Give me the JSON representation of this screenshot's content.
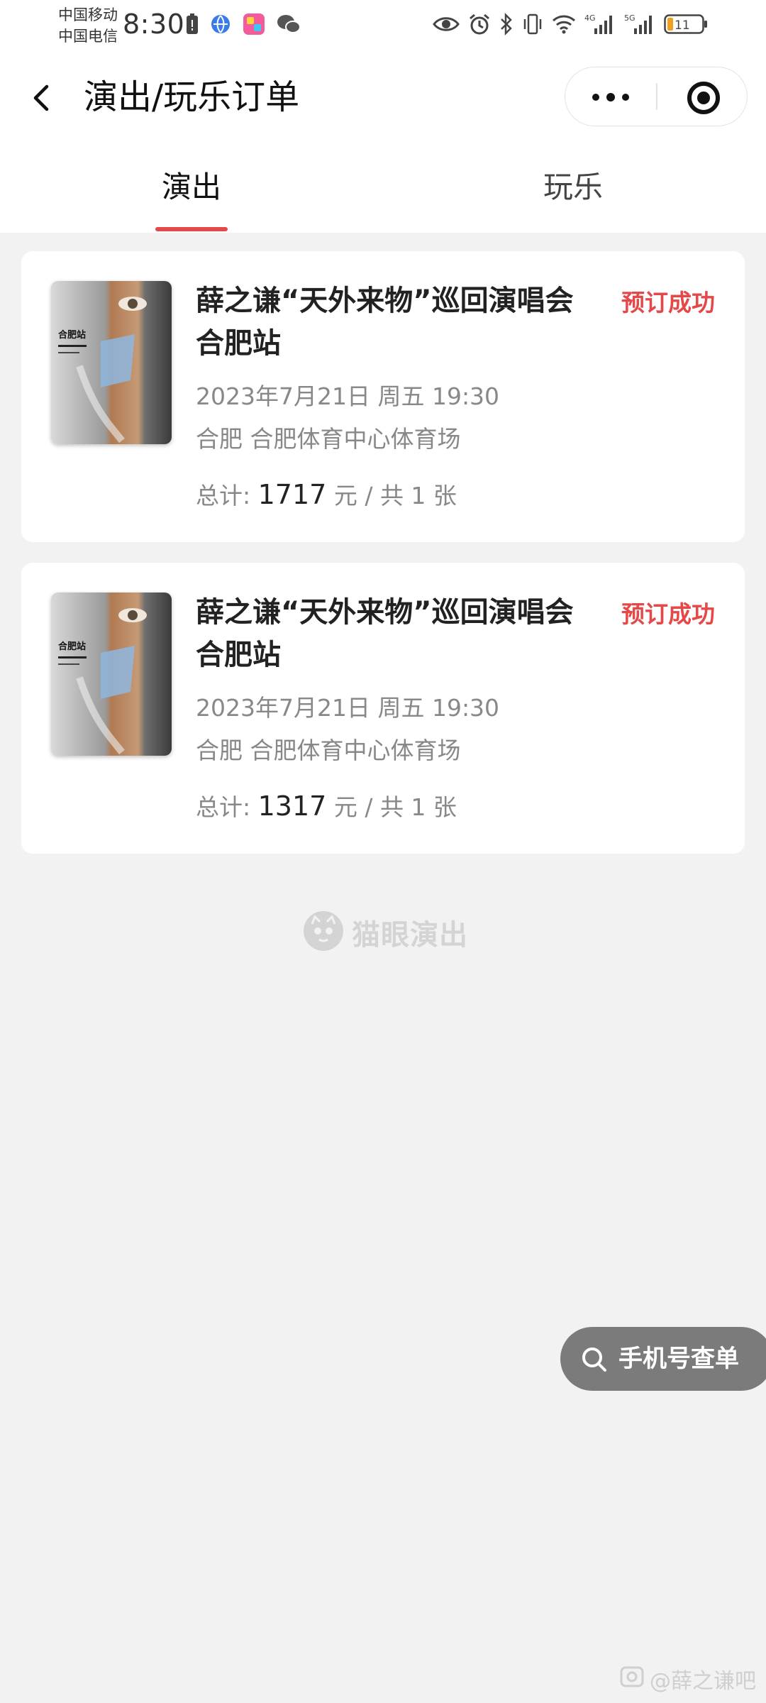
{
  "status_bar": {
    "carrier_1": "中国移动",
    "carrier_2": "中国电信",
    "time": "8:30",
    "network_1": "4G",
    "network_2": "5G",
    "battery": "11"
  },
  "nav": {
    "title": "演出/玩乐订单"
  },
  "tabs": [
    {
      "label": "演出",
      "active": true
    },
    {
      "label": "玩乐",
      "active": false
    }
  ],
  "orders": [
    {
      "title": "薛之谦“天外来物”巡回演唱会合肥站",
      "status": "预订成功",
      "datetime": "2023年7月21日 周五 19:30",
      "venue": "合肥 合肥体育中心体育场",
      "total_label": "总计:",
      "amount": "1717",
      "suffix": "元 / 共 1 张",
      "poster_text": "合肥站"
    },
    {
      "title": "薛之谦“天外来物”巡回演唱会合肥站",
      "status": "预订成功",
      "datetime": "2023年7月21日 周五 19:30",
      "venue": "合肥 合肥体育中心体育场",
      "total_label": "总计:",
      "amount": "1317",
      "suffix": "元 / 共 1 张",
      "poster_text": "合肥站"
    }
  ],
  "footer": {
    "logo_text": "猫眼演出"
  },
  "phone_lookup": {
    "label": "手机号查单"
  },
  "watermark": {
    "text": "@薛之谦吧"
  },
  "colors": {
    "accent": "#e54848",
    "background": "#f2f2f2",
    "lookup_button": "#7b7b7b"
  }
}
